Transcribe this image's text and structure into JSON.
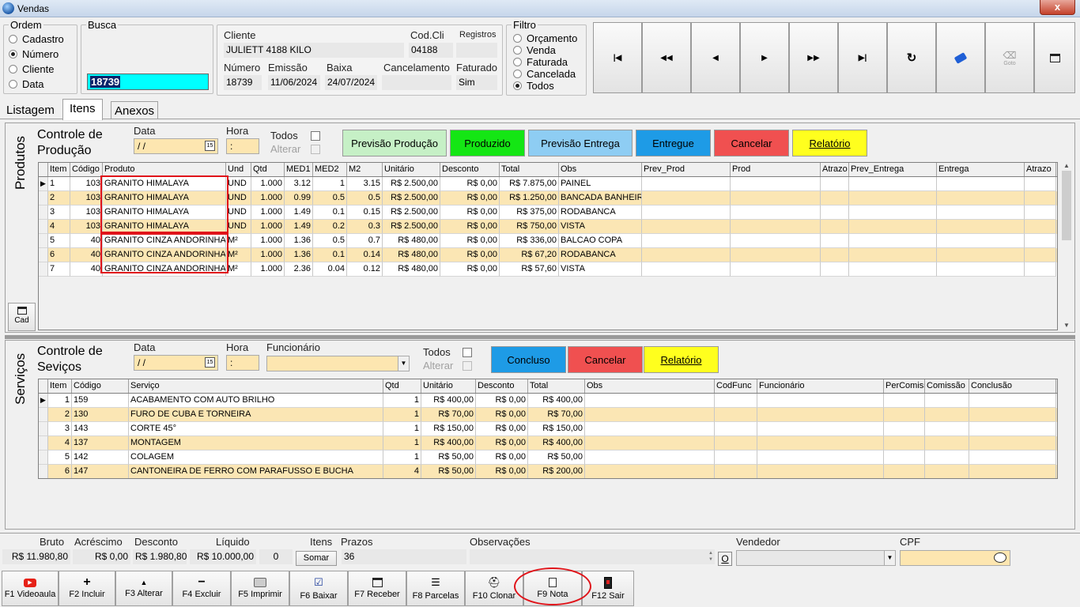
{
  "window": {
    "title": "Vendas",
    "close": "x"
  },
  "ordem": {
    "caption": "Ordem",
    "options": [
      "Cadastro",
      "Número",
      "Cliente",
      "Data"
    ],
    "selected": "Número"
  },
  "busca": {
    "caption": "Busca",
    "value": "18739"
  },
  "info": {
    "cliente_label": "Cliente",
    "cliente": "JULIETT 4188 KILO",
    "codcli_label": "Cod.Cli",
    "codcli": "04188",
    "registros_label": "Registros",
    "registros": "",
    "numero_label": "Número",
    "numero": "18739",
    "emissao_label": "Emissão",
    "emissao": "11/06/2024",
    "baixa_label": "Baixa",
    "baixa": "24/07/2024",
    "cancelamento_label": "Cancelamento",
    "cancelamento": "",
    "faturado_label": "Faturado",
    "faturado": "Sim"
  },
  "filtro": {
    "caption": "Filtro",
    "options": [
      "Orçamento",
      "Venda",
      "Faturada",
      "Cancelada",
      "Todos"
    ],
    "selected": "Todos"
  },
  "nav": {
    "icons": [
      "first-icon",
      "prev-page-icon",
      "prev-icon",
      "next-icon",
      "next-page-icon",
      "last-icon",
      "refresh-icon",
      "tag-icon",
      "goto-icon",
      "form-icon"
    ],
    "goto_label": "Goto"
  },
  "tabs": [
    "Listagem",
    "Itens",
    "Anexos"
  ],
  "produtos": {
    "side": "Produtos",
    "title1": "Controle de",
    "title2": "Produção",
    "data_label": "Data",
    "data_value": "/ /",
    "hora_label": "Hora",
    "hora_value": ":",
    "todos": "Todos",
    "alterar": "Alterar",
    "buttons": [
      {
        "label": "Previsão Produção",
        "color": "#c6f0c6"
      },
      {
        "label": "Produzido",
        "color": "#14e614"
      },
      {
        "label": "Previsão Entrega",
        "color": "#8ecdf3"
      },
      {
        "label": "Entregue",
        "color": "#1e9be6"
      },
      {
        "label": "Cancelar",
        "color": "#f05050"
      },
      {
        "label": "Relatório",
        "color": "#ffff1e"
      }
    ],
    "cad": "Cad",
    "columns": [
      "Item",
      "Código",
      "Produto",
      "Und",
      "Qtd",
      "MED1",
      "MED2",
      "M2",
      "Unitário",
      "Desconto",
      "Total",
      "Obs",
      "Prev_Prod",
      "Prod",
      "Atrazo",
      "Prev_Entrega",
      "Entrega",
      "Atrazo"
    ],
    "rows": [
      [
        "1",
        "103",
        "GRANITO HIMALAYA",
        "UND",
        "1.000",
        "3.12",
        "1",
        "3.15",
        "R$ 2.500,00",
        "R$ 0,00",
        "R$ 7.875,00",
        "PAINEL"
      ],
      [
        "2",
        "103",
        "GRANITO HIMALAYA",
        "UND",
        "1.000",
        "0.99",
        "0.5",
        "0.5",
        "R$ 2.500,00",
        "R$ 0,00",
        "R$ 1.250,00",
        "BANCADA BANHEIR"
      ],
      [
        "3",
        "103",
        "GRANITO HIMALAYA",
        "UND",
        "1.000",
        "1.49",
        "0.1",
        "0.15",
        "R$ 2.500,00",
        "R$ 0,00",
        "R$ 375,00",
        "RODABANCA"
      ],
      [
        "4",
        "103",
        "GRANITO HIMALAYA",
        "UND",
        "1.000",
        "1.49",
        "0.2",
        "0.3",
        "R$ 2.500,00",
        "R$ 0,00",
        "R$ 750,00",
        "VISTA"
      ],
      [
        "5",
        "40",
        "GRANITO CINZA ANDORINHA",
        "M²",
        "1.000",
        "1.36",
        "0.5",
        "0.7",
        "R$ 480,00",
        "R$ 0,00",
        "R$ 336,00",
        "BALCAO COPA"
      ],
      [
        "6",
        "40",
        "GRANITO CINZA ANDORINHA",
        "M²",
        "1.000",
        "1.36",
        "0.1",
        "0.14",
        "R$ 480,00",
        "R$ 0,00",
        "R$ 67,20",
        "RODABANCA"
      ],
      [
        "7",
        "40",
        "GRANITO CINZA ANDORINHA",
        "M²",
        "1.000",
        "2.36",
        "0.04",
        "0.12",
        "R$ 480,00",
        "R$ 0,00",
        "R$ 57,60",
        "VISTA"
      ]
    ]
  },
  "servicos": {
    "side": "Serviços",
    "title1": "Controle de",
    "title2": "Seviços",
    "data_label": "Data",
    "data_value": "/ /",
    "hora_label": "Hora",
    "hora_value": ":",
    "funcionario_label": "Funcionário",
    "todos": "Todos",
    "alterar": "Alterar",
    "buttons": [
      {
        "label": "Concluso",
        "color": "#1e9be6"
      },
      {
        "label": "Cancelar",
        "color": "#f05050"
      },
      {
        "label": "Relatório",
        "color": "#ffff1e"
      }
    ],
    "columns": [
      "Item",
      "Código",
      "Serviço",
      "Qtd",
      "Unitário",
      "Desconto",
      "Total",
      "Obs",
      "CodFunc",
      "Funcionário",
      "PerComiss",
      "Comissão",
      "Conclusão"
    ],
    "rows": [
      [
        "1",
        "159",
        "ACABAMENTO COM AUTO BRILHO",
        "1",
        "R$ 400,00",
        "R$ 0,00",
        "R$ 400,00"
      ],
      [
        "2",
        "130",
        "FURO DE CUBA E TORNEIRA",
        "1",
        "R$ 70,00",
        "R$ 0,00",
        "R$ 70,00"
      ],
      [
        "3",
        "143",
        "CORTE 45°",
        "1",
        "R$ 150,00",
        "R$ 0,00",
        "R$ 150,00"
      ],
      [
        "4",
        "137",
        "MONTAGEM",
        "1",
        "R$ 400,00",
        "R$ 0,00",
        "R$ 400,00"
      ],
      [
        "5",
        "142",
        "COLAGEM",
        "1",
        "R$ 50,00",
        "R$ 0,00",
        "R$ 50,00"
      ],
      [
        "6",
        "147",
        "CANTONEIRA DE FERRO COM PARAFUSSO E BUCHA",
        "4",
        "R$ 50,00",
        "R$ 0,00",
        "R$ 200,00"
      ]
    ]
  },
  "totals": {
    "bruto_label": "Bruto",
    "bruto": "R$ 11.980,80",
    "acrescimo_label": "Acréscimo",
    "acrescimo": "R$ 0,00",
    "desconto_label": "Desconto",
    "desconto": "R$ 1.980,80",
    "liquido_label": "Líquido",
    "liquido": "R$ 10.000,00",
    "itens_label": "Itens",
    "itens": "0",
    "somar": "Somar",
    "prazos_label": "Prazos",
    "prazos": "36",
    "obs_label": "Observações",
    "o_btn": "O",
    "vendedor_label": "Vendedor",
    "cpf_label": "CPF"
  },
  "fkeys": [
    {
      "label": "F1 Videoaula",
      "icon": "youtube-icon"
    },
    {
      "label": "F2 Incluir",
      "icon": "plus-icon"
    },
    {
      "label": "F3 Alterar",
      "icon": "up-triangle-icon"
    },
    {
      "label": "F4 Excluir",
      "icon": "minus-icon"
    },
    {
      "label": "F5 Imprimir",
      "icon": "printer-icon"
    },
    {
      "label": "F6 Baixar",
      "icon": "check-doc-icon"
    },
    {
      "label": "F7 Receber",
      "icon": "receipt-icon"
    },
    {
      "label": "F8 Parcelas",
      "icon": "list-icon"
    },
    {
      "label": "F10 Clonar",
      "icon": "clone-icon"
    },
    {
      "label": "F9 Nota",
      "icon": "note-icon"
    },
    {
      "label": "F12 Sair",
      "icon": "exit-icon"
    }
  ]
}
